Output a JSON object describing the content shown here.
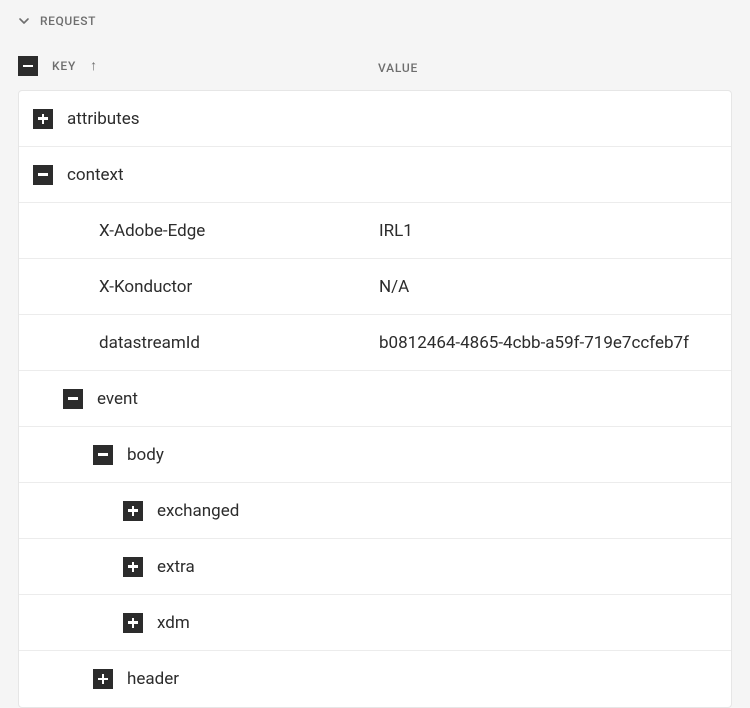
{
  "section": {
    "title": "REQUEST"
  },
  "columns": {
    "key": "KEY",
    "value": "VALUE"
  },
  "tree": {
    "attributes": {
      "label": "attributes"
    },
    "context": {
      "label": "context",
      "xAdobeEdge": {
        "key": "X-Adobe-Edge",
        "value": "IRL1"
      },
      "xKonductor": {
        "key": "X-Konductor",
        "value": "N/A"
      },
      "datastreamId": {
        "key": "datastreamId",
        "value": "b0812464-4865-4cbb-a59f-719e7ccfeb7f"
      },
      "event": {
        "label": "event",
        "body": {
          "label": "body",
          "exchanged": {
            "label": "exchanged"
          },
          "extra": {
            "label": "extra"
          },
          "xdm": {
            "label": "xdm"
          }
        },
        "header": {
          "label": "header"
        }
      }
    }
  }
}
